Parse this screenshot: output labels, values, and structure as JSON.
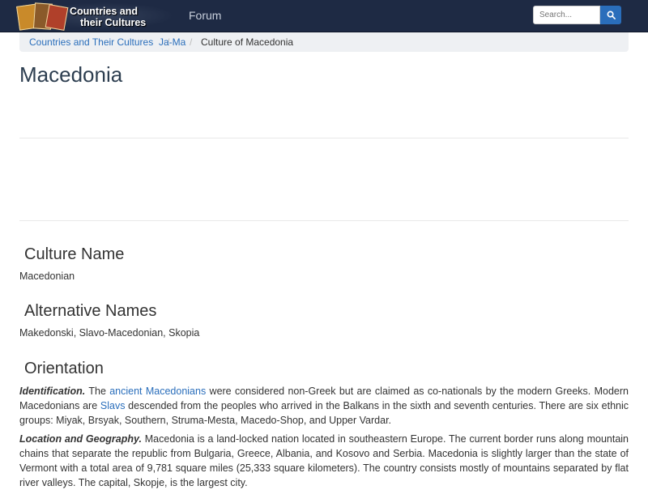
{
  "header": {
    "logo_line1": "Countries and",
    "logo_line2": "their Cultures",
    "nav_forum": "Forum",
    "search_placeholder": "Search...",
    "colors": {
      "navbar": "#1e2a44",
      "search_button": "#2a6ebb"
    }
  },
  "breadcrumb": {
    "items": [
      "Countries and Their Cultures",
      "Ja-Ma",
      "Culture of Macedonia"
    ],
    "separator": "/"
  },
  "page": {
    "title": "Macedonia"
  },
  "sections": {
    "culture_name": {
      "heading": "Culture Name",
      "text": "Macedonian"
    },
    "alternative_names": {
      "heading": "Alternative Names",
      "text": "Makedonski, Slavo-Macedonian, Skopia"
    },
    "orientation": {
      "heading": "Orientation",
      "identification": {
        "label": "Identification.",
        "t1": " The ",
        "link1": "ancient Macedonians",
        "t2": " were considered non-Greek but are claimed as co-nationals by the modern Greeks. Modern Macedonians are ",
        "link2": "Slavs",
        "t3": " descended from the peoples who arrived in the Balkans in the sixth and seventh centuries. There are six ethnic groups: Miyak, Brsyak, Southern, Struma-Mesta, Macedo-Shop, and Upper Vardar."
      },
      "location": {
        "label": "Location and Geography.",
        "text": " Macedonia is a land-locked nation located in southeastern Europe. The current border runs along mountain chains that separate the republic from Bulgaria, Greece, Albania, and Kosovo and Serbia. Macedonia is slightly larger than the state of Vermont with a total area of 9,781 square miles (25,333 square kilometers). The country consists mostly of mountains separated by flat river valleys. The capital, Skopje, is the largest city."
      }
    }
  }
}
